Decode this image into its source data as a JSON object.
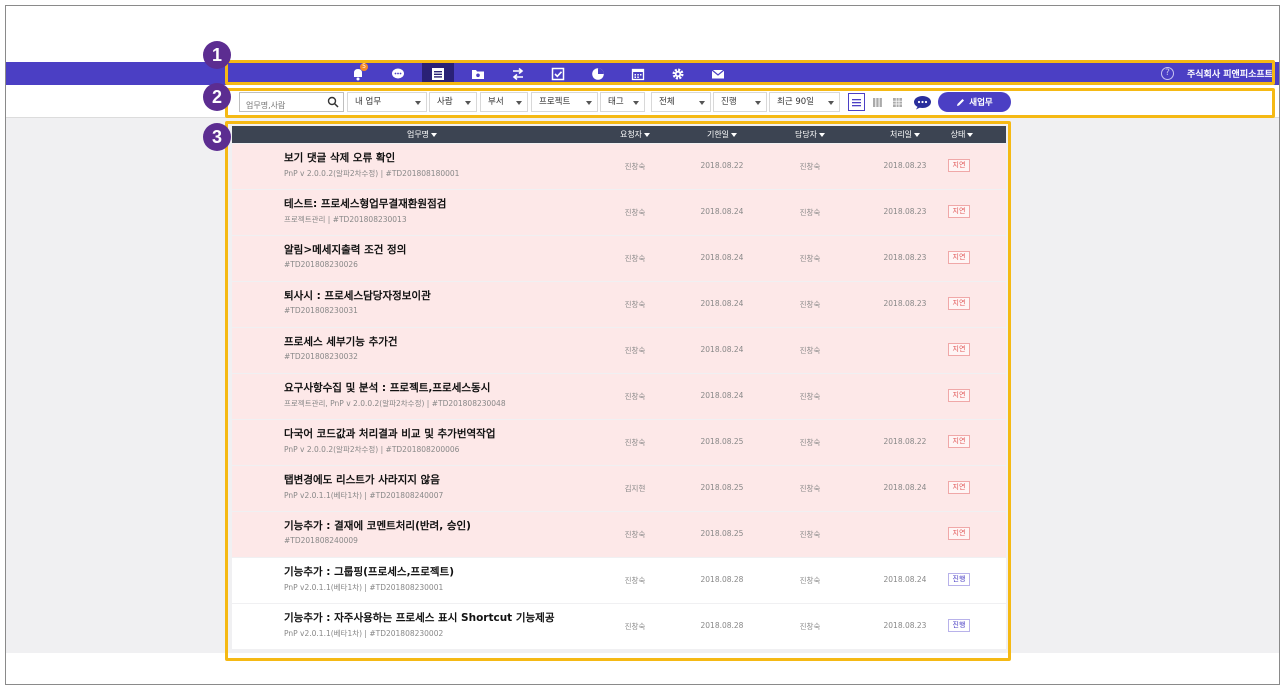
{
  "nav": {
    "icons": [
      "bell-icon",
      "chat-icon",
      "list-icon",
      "folder-icon",
      "transfer-icon",
      "checkbox-icon",
      "pie-chart-icon",
      "calendar-icon",
      "gear-icon",
      "mail-icon"
    ],
    "active_index": 2,
    "badge": "5",
    "help": "?",
    "company": "주식회사 피앤피소프트"
  },
  "filters": {
    "search_placeholder": "업무명,사람",
    "my_task": "내 업무",
    "person": "사람",
    "department": "부서",
    "project": "프로젝트",
    "tag": "태그",
    "all": "전체",
    "progress": "진행",
    "recent": "최근 90일",
    "new_task": "새업무"
  },
  "table": {
    "headers": {
      "name": "업무명",
      "requester": "요청자",
      "due": "기한일",
      "assignee": "담당자",
      "processed": "처리일",
      "status": "상태"
    },
    "rows": [
      {
        "title": "보기 댓글 삭제 오류 확인",
        "sub": "PnP v 2.0.0.2(알파2차수정) | #TD201808180001",
        "requester": "진창숙",
        "due": "2018.08.22",
        "assignee": "진창숙",
        "processed": "2018.08.23",
        "status": "지연",
        "late": true
      },
      {
        "title": "테스트: 프로세스형업무결재환원점검",
        "sub": "프로젝트관리 | #TD201808230013",
        "requester": "진창숙",
        "due": "2018.08.24",
        "assignee": "진창숙",
        "processed": "2018.08.23",
        "status": "지연",
        "late": true
      },
      {
        "title": "알림>메세지출력 조건 정의",
        "sub": "#TD201808230026",
        "requester": "진창숙",
        "due": "2018.08.24",
        "assignee": "진창숙",
        "processed": "2018.08.23",
        "status": "지연",
        "late": true
      },
      {
        "title": "퇴사시 : 프로세스담당자정보이관",
        "sub": "#TD201808230031",
        "requester": "진창숙",
        "due": "2018.08.24",
        "assignee": "진창숙",
        "processed": "2018.08.23",
        "status": "지연",
        "late": true
      },
      {
        "title": "프로세스 세부기능 추가건",
        "sub": "#TD201808230032",
        "requester": "진창숙",
        "due": "2018.08.24",
        "assignee": "진창숙",
        "processed": "",
        "status": "지연",
        "late": true
      },
      {
        "title": "요구사항수집 및 분석 : 프로젝트,프로세스동시",
        "sub": "프로젝트관리, PnP v 2.0.0.2(알파2차수정) | #TD201808230048",
        "requester": "진창숙",
        "due": "2018.08.24",
        "assignee": "진창숙",
        "processed": "",
        "status": "지연",
        "late": true
      },
      {
        "title": "다국어 코드값과 처리결과 비교 및 추가번역작업",
        "sub": "PnP v 2.0.0.2(알파2차수정) | #TD201808200006",
        "requester": "진창숙",
        "due": "2018.08.25",
        "assignee": "진창숙",
        "processed": "2018.08.22",
        "status": "지연",
        "late": true
      },
      {
        "title": "탭변경에도 리스트가 사라지지 않음",
        "sub": "PnP v2.0.1.1(베타1차) | #TD201808240007",
        "requester": "김지현",
        "due": "2018.08.25",
        "assignee": "진창숙",
        "processed": "2018.08.24",
        "status": "지연",
        "late": true
      },
      {
        "title": "기능추가 : 결재에 코멘트처리(반려, 승인)",
        "sub": "#TD201808240009",
        "requester": "진창숙",
        "due": "2018.08.25",
        "assignee": "진창숙",
        "processed": "",
        "status": "지연",
        "late": true
      },
      {
        "title": "기능추가 : 그룹핑(프로세스,프로젝트)",
        "sub": "PnP v2.0.1.1(베타1차) | #TD201808230001",
        "requester": "진창숙",
        "due": "2018.08.28",
        "assignee": "진창숙",
        "processed": "2018.08.24",
        "status": "진행",
        "late": false
      },
      {
        "title": "기능추가 : 자주사용하는 프로세스 표시 Shortcut 기능제공",
        "sub": "PnP v2.0.1.1(베타1차) | #TD201808230002",
        "requester": "진창숙",
        "due": "2018.08.28",
        "assignee": "진창숙",
        "processed": "2018.08.23",
        "status": "진행",
        "late": false
      }
    ]
  },
  "callouts": [
    "1",
    "2",
    "3"
  ],
  "colors": {
    "nav_bg": "#4b3fc4",
    "late_row": "#fde8e8",
    "highlight": "#f5b914",
    "callout": "#5c2d91"
  }
}
